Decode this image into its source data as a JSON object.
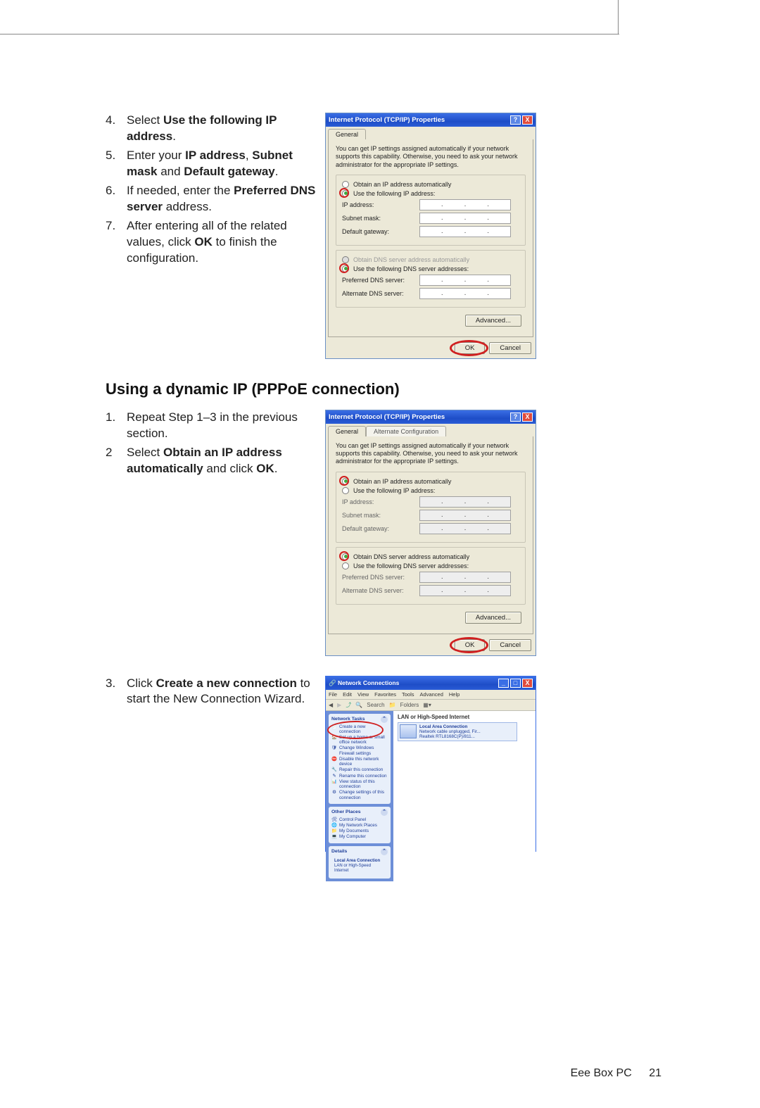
{
  "steps_top": [
    {
      "num": "4.",
      "parts": [
        "Select ",
        {
          "b": "Use the following IP address"
        },
        "."
      ]
    },
    {
      "num": "5.",
      "parts": [
        "Enter your ",
        {
          "b": "IP address"
        },
        ", ",
        {
          "b": "Subnet mask"
        },
        " and ",
        {
          "b": "Default gateway"
        },
        "."
      ]
    },
    {
      "num": "6.",
      "parts": [
        "If needed, enter the ",
        {
          "b": "Preferred DNS server"
        },
        " address."
      ]
    },
    {
      "num": "7.",
      "parts": [
        "After entering all of the related values, click ",
        {
          "b": "OK"
        },
        " to finish the configuration."
      ]
    }
  ],
  "heading": "Using a dynamic IP (PPPoE connection)",
  "steps_mid": [
    {
      "num": "1.",
      "parts": [
        "Repeat Step 1–3 in the previous section."
      ]
    },
    {
      "num": "2",
      "parts": [
        "Select ",
        {
          "b": "Obtain an IP address automatically"
        },
        " and click ",
        {
          "b": "OK"
        },
        "."
      ]
    }
  ],
  "steps_bot": [
    {
      "num": "3.",
      "parts": [
        "Click ",
        {
          "b": "Create a new connection"
        },
        " to start the New Connection Wizard."
      ]
    }
  ],
  "dialog": {
    "title": "Internet Protocol (TCP/IP) Properties",
    "tab_general": "General",
    "tab_alt": "Alternate Configuration",
    "desc": "You can get IP settings assigned automatically if your network supports this capability. Otherwise, you need to ask your network administrator for the appropriate IP settings.",
    "r_auto_ip": "Obtain an IP address automatically",
    "r_use_ip": "Use the following IP address:",
    "lbl_ip": "IP address:",
    "lbl_subnet": "Subnet mask:",
    "lbl_gateway": "Default gateway:",
    "r_auto_dns": "Obtain DNS server address automatically",
    "r_use_dns": "Use the following DNS server addresses:",
    "lbl_pref": "Preferred DNS server:",
    "lbl_alt": "Alternate DNS server:",
    "advanced": "Advanced...",
    "ok": "OK",
    "cancel": "Cancel"
  },
  "netwin": {
    "title": "Network Connections",
    "menus": [
      "File",
      "Edit",
      "View",
      "Favorites",
      "Tools",
      "Advanced",
      "Help"
    ],
    "toolbar_search": "Search",
    "toolbar_folders": "Folders",
    "panel_tasks_hd": "Network Tasks",
    "task_create": "Create a new connection",
    "task_home": "Set up a home or small office network",
    "task_fw": "Change Windows Firewall settings",
    "task_disable": "Disable this network device",
    "task_repair": "Repair this connection",
    "task_rename": "Rename this connection",
    "task_status": "View status of this connection",
    "task_change": "Change settings of this connection",
    "panel_other_hd": "Other Places",
    "other_cp": "Control Panel",
    "other_np": "My Network Places",
    "other_docs": "My Documents",
    "other_comp": "My Computer",
    "panel_details_hd": "Details",
    "details_l1": "Local Area Connection",
    "details_l2": "LAN or High-Speed Internet",
    "cat": "LAN or High-Speed Internet",
    "conn_name": "Local Area Connection",
    "conn_status": "Network cable unplugged, Fir...",
    "conn_adapter": "Realtek RTL8168C(P)/811..."
  },
  "footer_model": "Eee Box PC",
  "footer_page": "21"
}
